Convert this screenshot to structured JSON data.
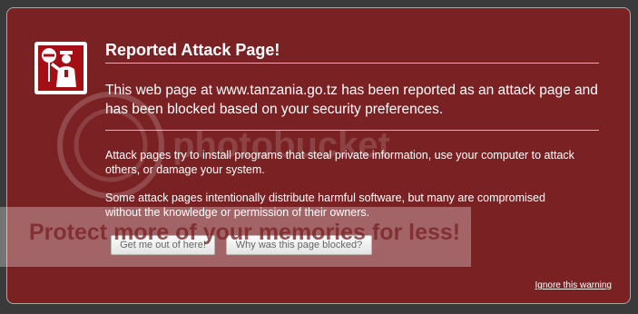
{
  "dialog": {
    "title": "Reported Attack Page!",
    "lead": "This web page at www.tanzania.go.tz has been reported as an attack page and has been blocked based on your security preferences.",
    "para1": "Attack pages try to install programs that steal private information, use your computer to attack others, or damage your system.",
    "para2": "Some attack pages intentionally distribute harmful software, but many are compromised without the knowledge or permission of their owners."
  },
  "buttons": {
    "get_out": "Get me out of here!",
    "why_blocked": "Why was this page blocked?"
  },
  "ignore_link": "Ignore this warning",
  "watermark": {
    "banner": "Protect more of your memories for less!",
    "logo": "photobucket"
  },
  "icons": {
    "warning": "police-officer-stop-icon"
  },
  "colors": {
    "background": "#7a2124",
    "icon_red": "#a40e15"
  }
}
